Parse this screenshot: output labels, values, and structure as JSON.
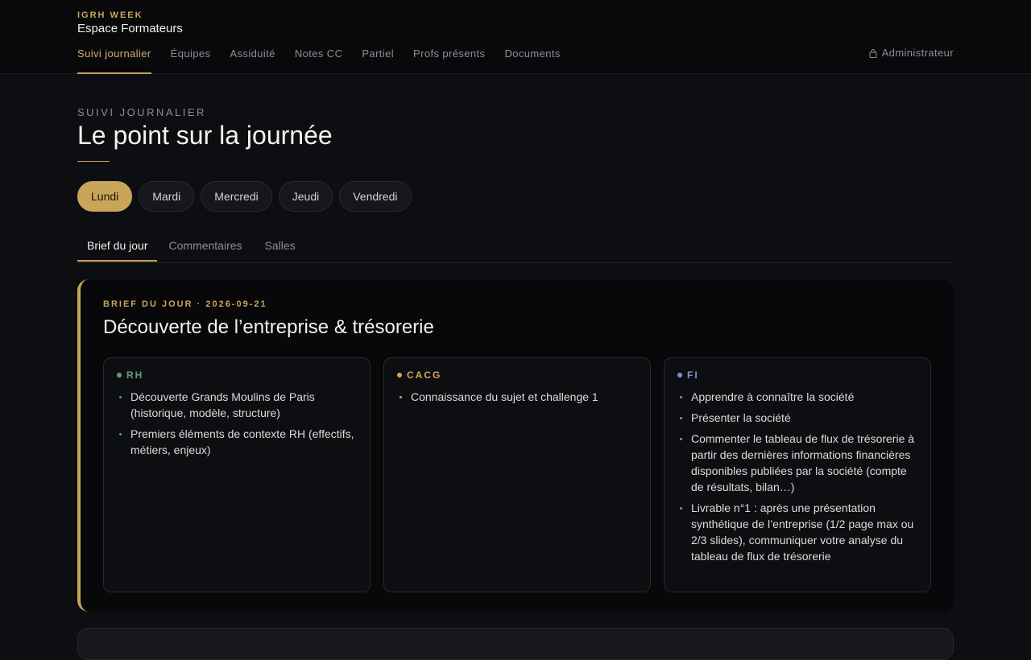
{
  "brand": {
    "kicker": "IGRH WEEK",
    "title": "Espace Formateurs"
  },
  "nav": {
    "items": [
      {
        "label": "Suivi journalier",
        "active": true
      },
      {
        "label": "Équipes"
      },
      {
        "label": "Assiduité"
      },
      {
        "label": "Notes CC"
      },
      {
        "label": "Partiel"
      },
      {
        "label": "Profs présents"
      },
      {
        "label": "Documents"
      }
    ],
    "admin_label": "Administrateur"
  },
  "page": {
    "kicker": "SUIVI JOURNALIER",
    "title": "Le point sur la journée"
  },
  "days": [
    "Lundi",
    "Mardi",
    "Mercredi",
    "Jeudi",
    "Vendredi"
  ],
  "subtabs": [
    "Brief du jour",
    "Commentaires",
    "Salles"
  ],
  "brief": {
    "kicker": "BRIEF DU JOUR · 2026-09-21",
    "title": "Découverte de l’entreprise & trésorerie",
    "columns": [
      {
        "label": "RH",
        "color": "#5fa07e",
        "items": [
          "Découverte Grands Moulins de Paris (historique, modèle, structure)",
          "Premiers éléments de contexte RH (effectifs, métiers, enjeux)"
        ]
      },
      {
        "label": "CACG",
        "color": "#d4a85a",
        "items": [
          "Connaissance du sujet et challenge 1"
        ]
      },
      {
        "label": "FI",
        "color": "#7d93c8",
        "items": [
          "Apprendre à connaître la société",
          "Présenter la société",
          "Commenter le tableau de flux de trésorerie à partir des dernières informations financières disponibles publiées par la société (compte de résultats, bilan…)",
          "Livrable n°1 : après une présentation synthétique de l’entreprise (1/2 page max ou 2/3 slides), communiquer votre analyse du tableau de flux de trésorerie"
        ]
      }
    ]
  },
  "colors": {
    "accent": "#c9a559",
    "background": "#0d0e12",
    "header": "#09090c"
  },
  "icons": {
    "admin": "lock-icon"
  }
}
